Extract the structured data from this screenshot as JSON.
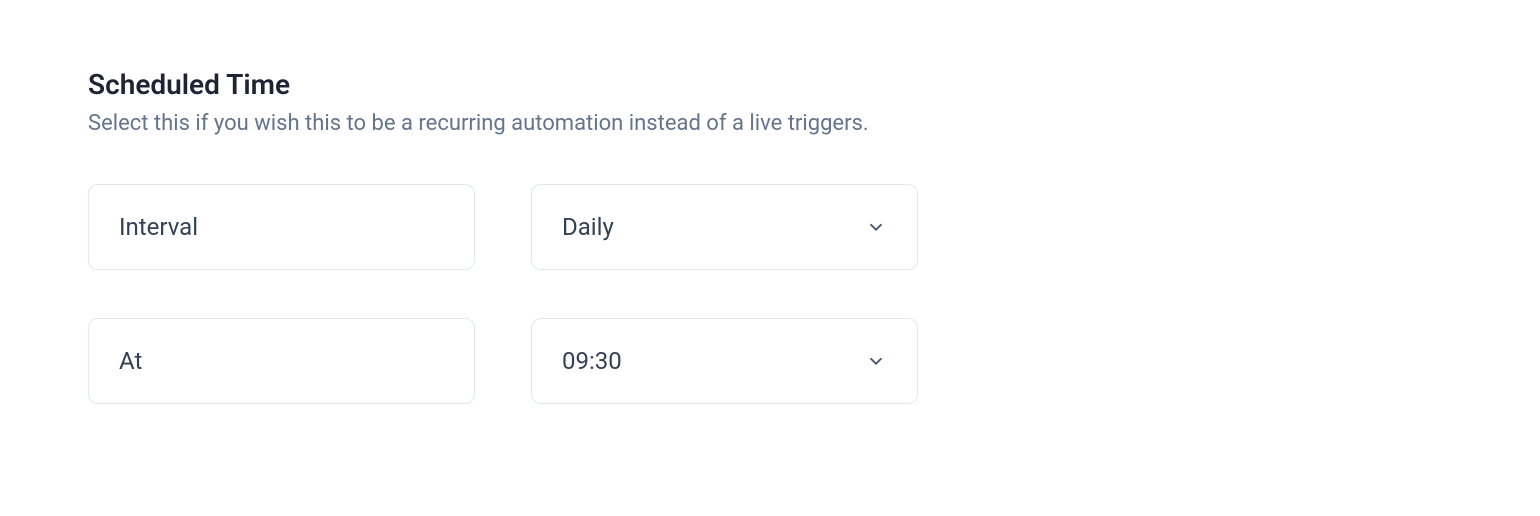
{
  "section": {
    "title": "Scheduled Time",
    "description": "Select this if you wish this to be a recurring automation instead of a live triggers."
  },
  "fields": {
    "interval": {
      "label": "Interval",
      "value": "Daily"
    },
    "at": {
      "label": "At",
      "value": "09:30"
    }
  }
}
